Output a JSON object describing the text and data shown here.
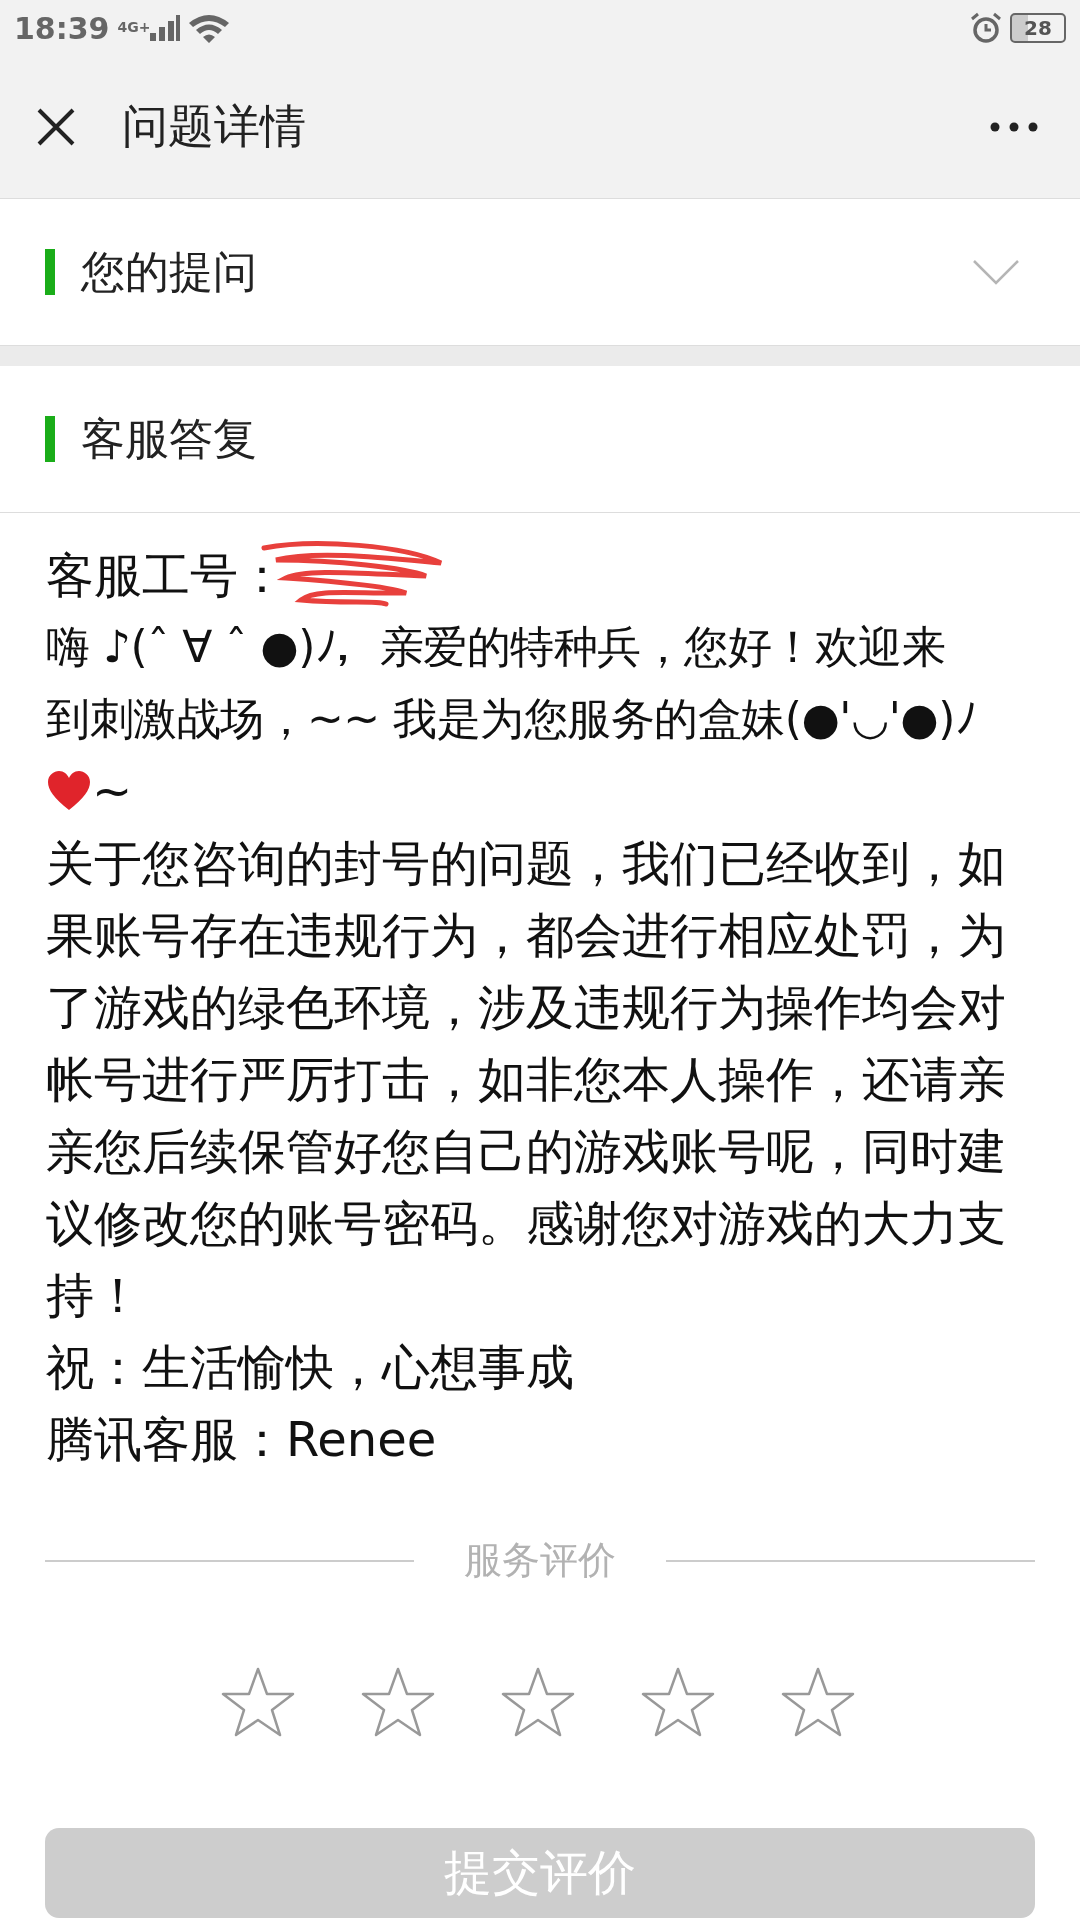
{
  "status_bar": {
    "time": "18:39",
    "network": "4G+",
    "battery": "28"
  },
  "header": {
    "title": "问题详情"
  },
  "sections": [
    {
      "title": "您的提问",
      "expanded": false
    },
    {
      "title": "客服答复",
      "expanded": true
    }
  ],
  "reply": {
    "staff_label": "客服工号：",
    "greeting_lines": [
      "嗨 ♪(ˆ ∀ ˆ ●)ﾉ，亲爱的特种兵，您好！欢迎来",
      "到刺激战场，~~ 我是为您服务的盒妹(●'◡'●)ﾉ"
    ],
    "greeting_tail": "~",
    "paragraphs": [
      "关于您咨询的封号的问题，我们已经收到，如果账号存在违规行为，都会进行相应处罚，为了游戏的绿色环境，涉及违规行为操作均会对帐号进行严厉打击，如非您本人操作，还请亲亲您后续保管好您自己的游戏账号呢，同时建议修改您的账号密码。感谢您对游戏的大力支持！",
      "祝：生活愉快，心想事成",
      "腾讯客服：Renee"
    ]
  },
  "rating": {
    "title": "服务评价",
    "stars": 0
  },
  "submit_button": {
    "label": "提交评价",
    "disabled": true
  }
}
